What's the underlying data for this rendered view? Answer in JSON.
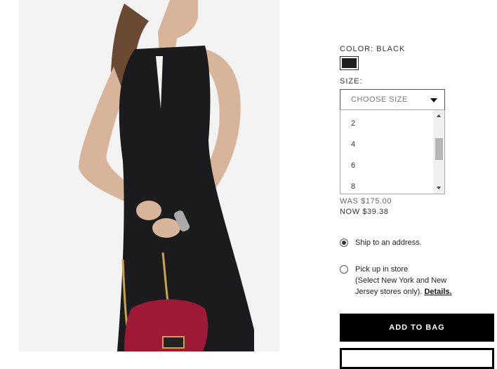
{
  "product": {
    "color_label": "COLOR: BLACK",
    "swatch_color": "#1e1e1e",
    "size_label": "SIZE:",
    "size_select": {
      "value": "CHOOSE SIZE",
      "options": [
        "2",
        "4",
        "6",
        "8"
      ]
    },
    "price_was": "WAS $175.00",
    "price_now": "NOW $39.38"
  },
  "shipping": {
    "ship_label": "Ship to an address.",
    "pickup_label": "Pick up in store",
    "pickup_note_line1": "(Select New York and New",
    "pickup_note_line2": "Jersey stores only).",
    "details_link": "Details.",
    "selected": "ship"
  },
  "actions": {
    "add_to_bag": "ADD TO BAG"
  }
}
